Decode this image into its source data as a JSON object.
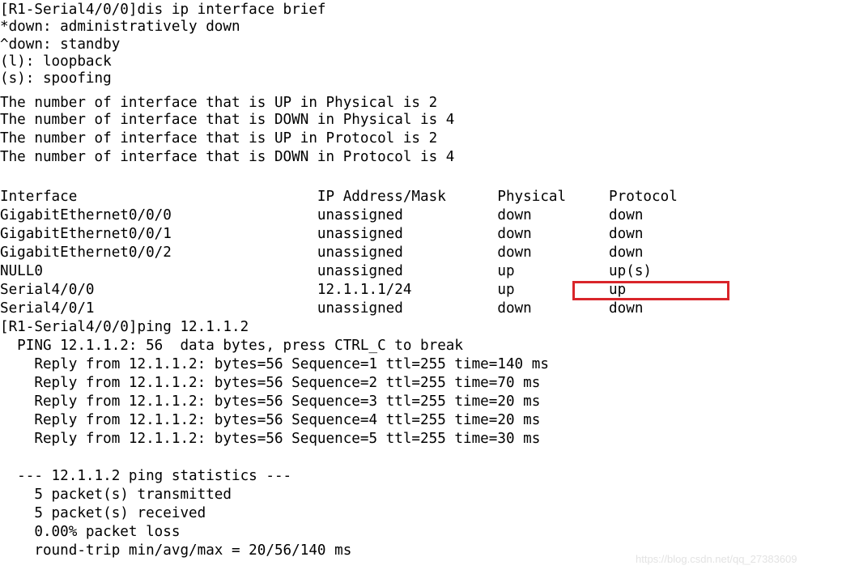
{
  "terminal": {
    "background_color": "#ffffff",
    "text_color": "#000000",
    "highlight_color": "#d9252a",
    "prompt": "[R1-Serial4/0/0]",
    "lines": [
      "[R1-Serial4/0/0]dis ip interface brief",
      "*down: administratively down",
      "^down: standby",
      "(l): loopback",
      "(s): spoofing",
      "The number of interface that is UP in Physical is 2",
      "The number of interface that is DOWN in Physical is 4",
      "The number of interface that is UP in Protocol is 2",
      "The number of interface that is DOWN in Protocol is 4",
      "",
      "Interface                            IP Address/Mask      Physical     Protocol",
      "GigabitEthernet0/0/0                 unassigned           down         down",
      "GigabitEthernet0/0/1                 unassigned           down         down",
      "GigabitEthernet0/0/2                 unassigned           down         down",
      "NULL0                                unassigned           up           up(s)",
      "Serial4/0/0                          12.1.1.1/24          up           up",
      "Serial4/0/1                          unassigned           down         down",
      "[R1-Serial4/0/0]ping 12.1.1.2",
      "  PING 12.1.1.2: 56  data bytes, press CTRL_C to break",
      "    Reply from 12.1.1.2: bytes=56 Sequence=1 ttl=255 time=140 ms",
      "    Reply from 12.1.1.2: bytes=56 Sequence=2 ttl=255 time=70 ms",
      "    Reply from 12.1.1.2: bytes=56 Sequence=3 ttl=255 time=20 ms",
      "    Reply from 12.1.1.2: bytes=56 Sequence=4 ttl=255 time=20 ms",
      "    Reply from 12.1.1.2: bytes=56 Sequence=5 ttl=255 time=30 ms",
      "",
      "  --- 12.1.1.2 ping statistics ---",
      "    5 packet(s) transmitted",
      "    5 packet(s) received",
      "    0.00% packet loss",
      "    round-trip min/avg/max = 20/56/140 ms"
    ],
    "command_entered": "dis ip interface brief",
    "legend": {
      "administratively_down": "*down: administratively down",
      "standby": "^down: standby",
      "loopback": "(l): loopback",
      "spoofing": "(s): spoofing"
    },
    "summary": {
      "up_physical": "2",
      "down_physical": "4",
      "up_protocol": "2",
      "down_protocol": "4"
    },
    "interface_table": {
      "headers": [
        "Interface",
        "IP Address/Mask",
        "Physical",
        "Protocol"
      ],
      "rows": [
        [
          "GigabitEthernet0/0/0",
          "unassigned",
          "down",
          "down"
        ],
        [
          "GigabitEthernet0/0/1",
          "unassigned",
          "down",
          "down"
        ],
        [
          "GigabitEthernet0/0/2",
          "unassigned",
          "down",
          "down"
        ],
        [
          "NULL0",
          "unassigned",
          "up",
          "up(s)"
        ],
        [
          "Serial4/0/0",
          "12.1.1.1/24",
          "up",
          "up"
        ],
        [
          "Serial4/0/1",
          "unassigned",
          "down",
          "down"
        ]
      ],
      "highlighted_row": "Serial4/0/0",
      "highlighted_cells": [
        "up",
        "up"
      ]
    },
    "ping": {
      "command": "ping 12.1.1.2",
      "target": "12.1.1.2",
      "banner": "PING 12.1.1.2: 56  data bytes, press CTRL_C to break",
      "replies": [
        {
          "sequence": "1",
          "bytes": "56",
          "ttl": "255",
          "time": "140 ms"
        },
        {
          "sequence": "2",
          "bytes": "56",
          "ttl": "255",
          "time": "70 ms"
        },
        {
          "sequence": "3",
          "bytes": "56",
          "ttl": "255",
          "time": "20 ms"
        },
        {
          "sequence": "4",
          "bytes": "56",
          "ttl": "255",
          "time": "20 ms"
        },
        {
          "sequence": "5",
          "bytes": "56",
          "ttl": "255",
          "time": "30 ms"
        }
      ],
      "statistics_header": "--- 12.1.1.2 ping statistics ---",
      "transmitted": "5 packet(s) transmitted",
      "received": "5 packet(s) received",
      "loss": "0.00% packet loss",
      "round_trip": "round-trip min/avg/max = 20/56/140 ms"
    }
  },
  "watermark": {
    "text": "https://blog.csdn.net/qq_27383609"
  }
}
